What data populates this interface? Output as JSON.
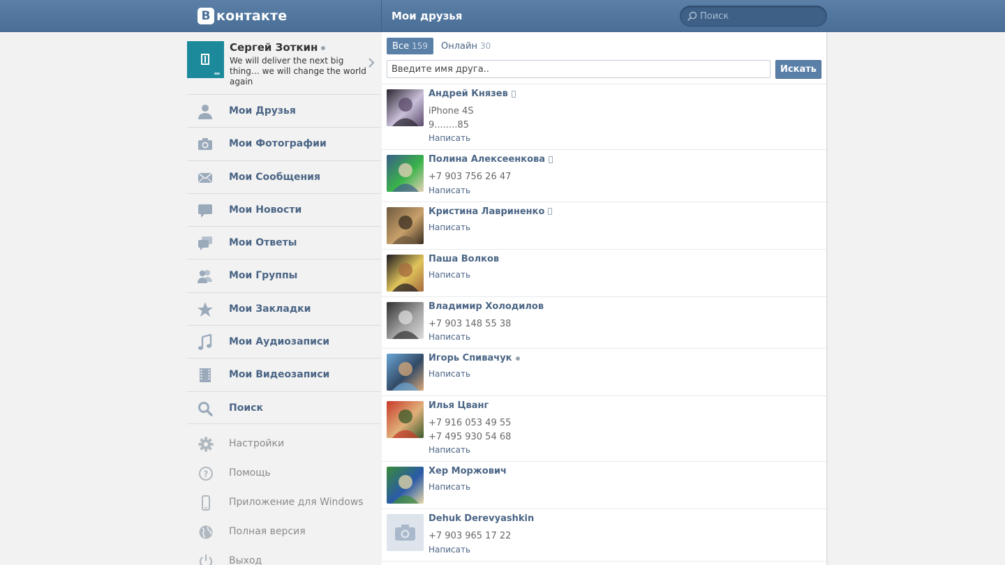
{
  "header": {
    "logo_badge": "В",
    "logo_text": "контакте",
    "page_title": "Мои друзья",
    "search_placeholder": "Поиск"
  },
  "profile": {
    "name": "Сергей Зоткин",
    "status": "We will deliver the next big thing… we will change the world again"
  },
  "menu": [
    {
      "label": "Мои Друзья",
      "icon": "person-icon"
    },
    {
      "label": "Мои Фотографии",
      "icon": "camera-icon"
    },
    {
      "label": "Мои Сообщения",
      "icon": "envelope-icon"
    },
    {
      "label": "Мои Новости",
      "icon": "speech-bubble-icon"
    },
    {
      "label": "Мои Ответы",
      "icon": "chat-bubbles-icon"
    },
    {
      "label": "Мои Группы",
      "icon": "people-icon"
    },
    {
      "label": "Мои Закладки",
      "icon": "star-icon"
    },
    {
      "label": "Мои Аудиозаписи",
      "icon": "music-note-icon"
    },
    {
      "label": "Мои Видеозаписи",
      "icon": "film-icon"
    },
    {
      "label": "Поиск",
      "icon": "search-icon"
    }
  ],
  "secondary_menu": [
    {
      "label": "Настройки",
      "icon": "gear-icon"
    },
    {
      "label": "Помощь",
      "icon": "help-icon"
    },
    {
      "label": "Приложение для Windows",
      "icon": "phone-icon"
    },
    {
      "label": "Полная версия",
      "icon": "globe-icon"
    },
    {
      "label": "Выход",
      "icon": "power-icon"
    }
  ],
  "tabs": [
    {
      "label": "Все",
      "count": "159",
      "active": true
    },
    {
      "label": "Онлайн",
      "count": "30",
      "active": false
    }
  ],
  "friend_search": {
    "placeholder": "Введите имя друга..",
    "button": "Искать"
  },
  "write_label": "Написать",
  "friends": [
    {
      "name": "Андрей Князев",
      "indicator": "mobile",
      "info": [
        "iPhone 4S",
        "9........85"
      ],
      "avatar_colors": [
        "#2a2530",
        "#c9bfd9",
        "#5a4a6a"
      ]
    },
    {
      "name": "Полина Алексеенкова",
      "indicator": "mobile",
      "info": [
        "+7 903 756 26 47"
      ],
      "avatar_colors": [
        "#3b5e88",
        "#39b34a",
        "#e8d2b8"
      ]
    },
    {
      "name": "Кристина Лавриненко",
      "indicator": "mobile",
      "info": [],
      "avatar_colors": [
        "#6e5a3e",
        "#c8a06a",
        "#3a2e22"
      ]
    },
    {
      "name": "Паша Волков",
      "indicator": "",
      "info": [],
      "avatar_colors": [
        "#1e1a22",
        "#e0c45a",
        "#a46a3e"
      ]
    },
    {
      "name": "Владимир Холодилов",
      "indicator": "",
      "info": [
        "+7 903 148 55 38"
      ],
      "avatar_colors": [
        "#303030",
        "#a0a0a0",
        "#dcdcdc"
      ]
    },
    {
      "name": "Игорь Спивачук",
      "indicator": "online",
      "info": [],
      "avatar_colors": [
        "#6aa6d6",
        "#324a66",
        "#d8a87a"
      ]
    },
    {
      "name": "Илья Цванг",
      "indicator": "",
      "info": [
        "+7 916 053 49 55",
        "+7 495 930 54 68"
      ],
      "avatar_colors": [
        "#c83a2a",
        "#e0b07a",
        "#3a5a2a"
      ]
    },
    {
      "name": "Хер Моржович",
      "indicator": "",
      "info": [],
      "avatar_colors": [
        "#3a8a3a",
        "#2a5aa8",
        "#e8d8a8"
      ]
    },
    {
      "name": "Dehuk Derevyashkin",
      "indicator": "",
      "info": [
        "+7 903 965 17 22"
      ],
      "avatar_colors": [
        "#dde4ec",
        "#a9b9cb",
        "#ffffff"
      ],
      "placeholder_avatar": true
    }
  ]
}
